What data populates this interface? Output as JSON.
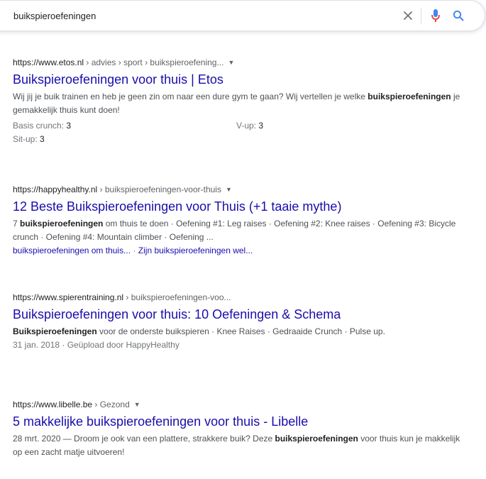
{
  "search": {
    "query": "buikspieroefeningen"
  },
  "results": [
    {
      "url_base": "https://www.etos.nl",
      "url_crumbs": " › advies › sport › buikspieroefening...",
      "title": "Buikspieroefeningen voor thuis | Etos",
      "snippet_a": "Wij jij je buik trainen en heb je geen zin om naar een dure gym te gaan? Wij vertellen je welke ",
      "snippet_bold": "buikspieroefeningen",
      "snippet_b": " je gemakkelijk thuis kunt doen!",
      "facts": [
        {
          "label": "Basis crunch: ",
          "value": "3"
        },
        {
          "label": "V-up: ",
          "value": "3"
        },
        {
          "label": "Sit-up: ",
          "value": "3"
        }
      ]
    },
    {
      "url_base": "https://happyhealthy.nl",
      "url_crumbs": " › buikspieroefeningen-voor-thuis",
      "title": "12 Beste Buikspieroefeningen voor Thuis (+1 taaie mythe)",
      "snippet_a": "7 ",
      "snippet_bold": "buikspieroefeningen",
      "snippet_b": " om thuis te doen · Oefening #1: Leg raises · Oefening #2: Knee raises · Oefening #3: Bicycle crunch · Oefening #4: Mountain climber · Oefening ...",
      "sitelinks": [
        "buikspieroefeningen om thuis...",
        "Zijn buikspieroefeningen wel..."
      ],
      "sitelink_sep": " · "
    },
    {
      "url_base": "https://www.spierentraining.nl",
      "url_crumbs": " › buikspieroefeningen-voo...",
      "title": "Buikspieroefeningen voor thuis: 10 Oefeningen & Schema",
      "snippet_bold": "Buikspieroefeningen",
      "snippet_b": " voor de onderste buikspieren · Knee Raises · Gedraaide Crunch · Pulse up.",
      "meta": "31 jan. 2018 · Geüpload door HappyHealthy"
    },
    {
      "url_base": "https://www.libelle.be",
      "url_crumbs": " › Gezond",
      "title": "5 makkelijke buikspieroefeningen voor thuis - Libelle",
      "snippet_a": "28 mrt. 2020 — Droom je ook van een plattere, strakkere buik? Deze ",
      "snippet_bold": "buikspieroefeningen",
      "snippet_b": " voor thuis kun je makkelijk op een zacht matje uitvoeren!"
    }
  ],
  "icons": {
    "clear": "close-icon",
    "mic": "microphone-icon",
    "search": "search-icon",
    "caret": "caret-down-icon"
  },
  "colors": {
    "link": "#1a0dab",
    "text": "#4d5156",
    "mic_blue": "#4285f4",
    "mic_red": "#ea4335"
  }
}
